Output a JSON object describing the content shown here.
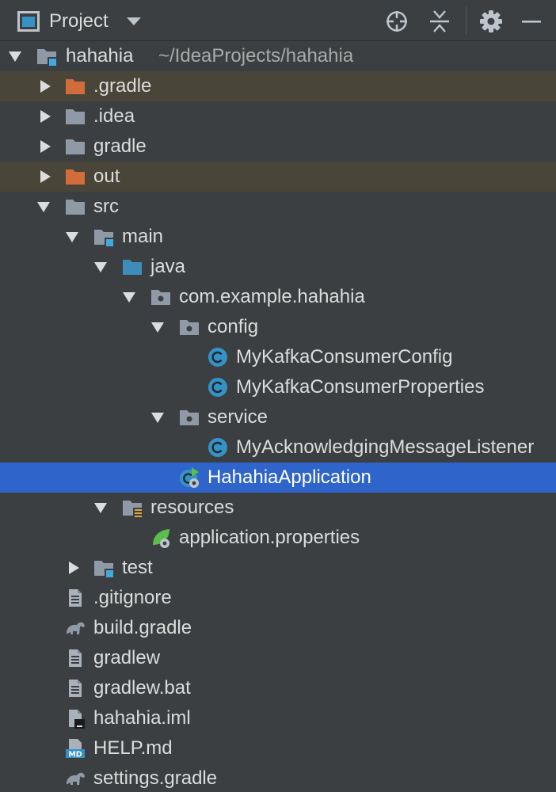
{
  "header": {
    "title": "Project",
    "icons": [
      "project-view-icon",
      "dropdown-caret-icon",
      "locate-icon",
      "collapse-all-icon",
      "gear-icon",
      "minimize-icon"
    ]
  },
  "colors": {
    "background": "#3c3f41",
    "selection": "#2f65ca",
    "excluded": "#4a4539",
    "folder": "#8f9aa6",
    "excluded_folder": "#d26c3a",
    "source_folder": "#3d8dbb",
    "class_icon": "#3592c4"
  },
  "tree": {
    "root": {
      "label": "hahahia",
      "path": "~/IdeaProjects/hahahia"
    },
    "gradle_dir": {
      "label": ".gradle"
    },
    "idea_dir": {
      "label": ".idea"
    },
    "gradle2_dir": {
      "label": "gradle"
    },
    "out_dir": {
      "label": "out"
    },
    "src_dir": {
      "label": "src"
    },
    "main_dir": {
      "label": "main"
    },
    "java_dir": {
      "label": "java"
    },
    "package": {
      "label": "com.example.hahahia"
    },
    "config_pkg": {
      "label": "config"
    },
    "config_class1": {
      "label": "MyKafkaConsumerConfig"
    },
    "config_class2": {
      "label": "MyKafkaConsumerProperties"
    },
    "service_pkg": {
      "label": "service"
    },
    "service_class": {
      "label": "MyAcknowledgingMessageListener"
    },
    "app_class": {
      "label": "HahahiaApplication"
    },
    "resources_dir": {
      "label": "resources"
    },
    "app_props": {
      "label": "application.properties"
    },
    "test_dir": {
      "label": "test"
    },
    "gitignore": {
      "label": ".gitignore"
    },
    "build_gradle": {
      "label": "build.gradle"
    },
    "gradlew": {
      "label": "gradlew"
    },
    "gradlew_bat": {
      "label": "gradlew.bat"
    },
    "iml": {
      "label": "hahahia.iml"
    },
    "help_md": {
      "label": "HELP.md"
    },
    "settings_gradle": {
      "label": "settings.gradle"
    }
  }
}
